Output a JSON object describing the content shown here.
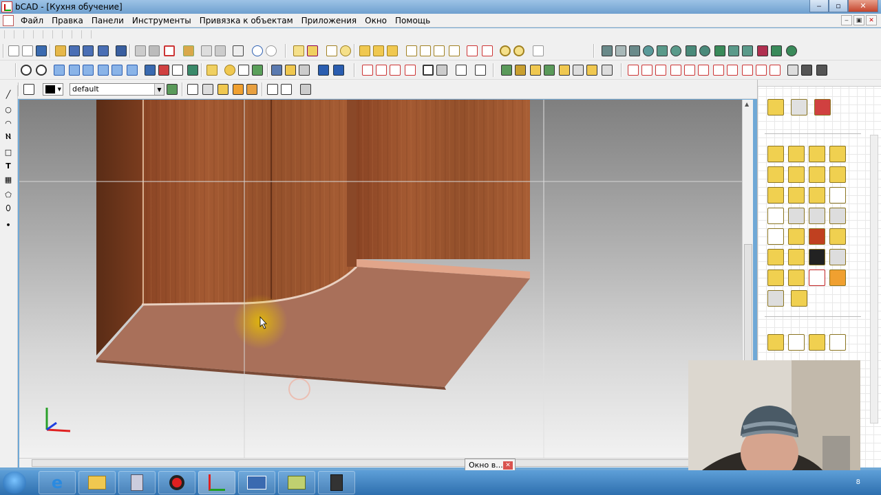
{
  "window": {
    "title": "bCAD - [Кухня обучение]"
  },
  "menu": {
    "items": [
      "Файл",
      "Правка",
      "Панели",
      "Инструменты",
      "Привязка к объектам",
      "Приложения",
      "Окно",
      "Помощь"
    ]
  },
  "layer_toolbar": {
    "layer_value": "default",
    "color_value": "#000000"
  },
  "popup": {
    "label": "Окно в..."
  },
  "tray": {
    "clock": "8"
  },
  "colors": {
    "wood": "#9a4f2a",
    "floor": "#a9705a",
    "accent": "#e2a58a",
    "titlebar": "#7ba9d6"
  }
}
